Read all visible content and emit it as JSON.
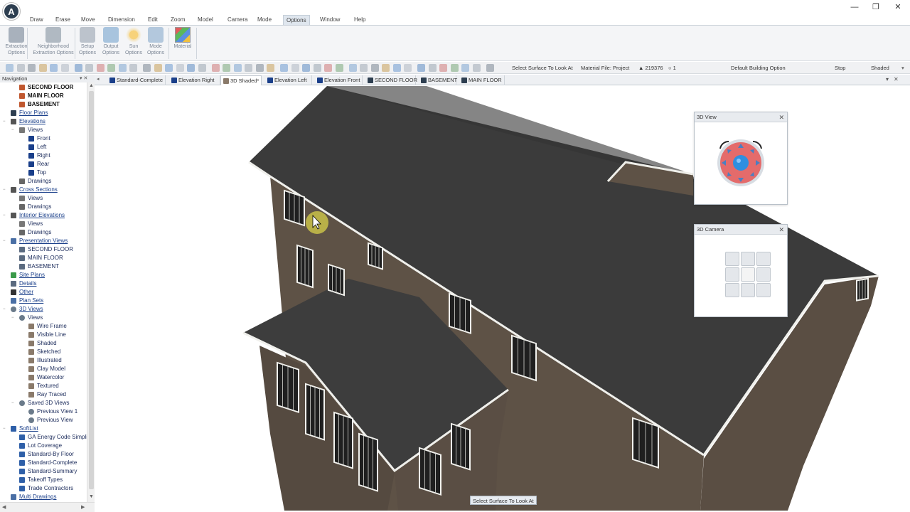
{
  "titlebar": {
    "minimize": "—",
    "restore": "❐",
    "close": "✕",
    "logo": "A"
  },
  "menu": [
    "Draw",
    "Erase",
    "Move",
    "Dimension",
    "Edit",
    "Zoom",
    "Model",
    "Camera",
    "Mode",
    "Options",
    "Window",
    "Help"
  ],
  "menu_active": "Options",
  "ribbon": [
    {
      "label1": "Extraction",
      "label2": "Options",
      "icon": "hammer-icon"
    },
    {
      "label1": "Neighborhood",
      "label2": "Extraction Options",
      "icon": "neighborhood-icon"
    },
    {
      "label1": "Setup",
      "label2": "Options",
      "icon": "setup-icon"
    },
    {
      "label1": "Output",
      "label2": "Options",
      "icon": "output-arrow-icon"
    },
    {
      "label1": "Sun",
      "label2": "Options",
      "icon": "sun-icon"
    },
    {
      "label1": "Mode",
      "label2": "Options",
      "icon": "house-icon"
    },
    {
      "label1": "Material",
      "label2": "",
      "icon": "material-swatch-icon"
    }
  ],
  "toolbar": {
    "select_surface": "Select Surface To Look At",
    "material_file": "Material File: Project",
    "count": "▲ 219376",
    "counter2": "○ 1",
    "building_option": "Default Building Option",
    "stop": "Stop",
    "render_mode": "Shaded"
  },
  "navigation": {
    "title": "Navigation",
    "pin": "▾ ✕",
    "items": [
      {
        "label": "SECOND FLOOR",
        "style": "bold",
        "indent": 2,
        "icon": "floor-icon"
      },
      {
        "label": "MAIN FLOOR",
        "style": "bold",
        "indent": 2,
        "icon": "floor-icon"
      },
      {
        "label": "BASEMENT",
        "style": "bold",
        "indent": 2,
        "icon": "floor-icon"
      },
      {
        "label": "Floor Plans",
        "style": "link",
        "indent": 1,
        "icon": "floorplan-icon"
      },
      {
        "label": "Elevations",
        "style": "link",
        "indent": 1,
        "icon": "house-icon",
        "exp": "−"
      },
      {
        "label": "Views",
        "style": "plain",
        "indent": 2,
        "icon": "folder-icon",
        "exp": "−"
      },
      {
        "label": "Front",
        "style": "plain",
        "indent": 3,
        "icon": "arrow-up-icon"
      },
      {
        "label": "Left",
        "style": "plain",
        "indent": 3,
        "icon": "arrow-right-icon"
      },
      {
        "label": "Right",
        "style": "plain",
        "indent": 3,
        "icon": "arrow-left-icon"
      },
      {
        "label": "Rear",
        "style": "plain",
        "indent": 3,
        "icon": "arrow-down-icon"
      },
      {
        "label": "Top",
        "style": "plain",
        "indent": 3,
        "icon": "top-view-icon"
      },
      {
        "label": "Drawings",
        "style": "plain",
        "indent": 2,
        "icon": "drawing-icon"
      },
      {
        "label": "Cross Sections",
        "style": "link",
        "indent": 1,
        "icon": "house-icon",
        "exp": "−"
      },
      {
        "label": "Views",
        "style": "plain",
        "indent": 2,
        "icon": "folder-icon"
      },
      {
        "label": "Drawings",
        "style": "plain",
        "indent": 2,
        "icon": "drawing-icon"
      },
      {
        "label": "Interior Elevations",
        "style": "link",
        "indent": 1,
        "icon": "interior-icon",
        "exp": "−"
      },
      {
        "label": "Views",
        "style": "plain",
        "indent": 2,
        "icon": "folder-icon"
      },
      {
        "label": "Drawings",
        "style": "plain",
        "indent": 2,
        "icon": "drawing-icon"
      },
      {
        "label": "Presentation Views",
        "style": "link",
        "indent": 1,
        "icon": "presentation-icon",
        "exp": "−"
      },
      {
        "label": "SECOND FLOOR",
        "style": "plain",
        "indent": 2,
        "icon": "sheet-icon"
      },
      {
        "label": "MAIN FLOOR",
        "style": "plain",
        "indent": 2,
        "icon": "sheet-icon"
      },
      {
        "label": "BASEMENT",
        "style": "plain",
        "indent": 2,
        "icon": "sheet-icon"
      },
      {
        "label": "Site Plans",
        "style": "link",
        "indent": 1,
        "icon": "site-plan-icon"
      },
      {
        "label": "Details",
        "style": "link",
        "indent": 1,
        "icon": "details-icon"
      },
      {
        "label": "Other",
        "style": "link",
        "indent": 1,
        "icon": "other-icon"
      },
      {
        "label": "Plan Sets",
        "style": "link",
        "indent": 1,
        "icon": "plan-sets-icon"
      },
      {
        "label": "3D Views",
        "style": "link",
        "indent": 1,
        "icon": "eye-icon",
        "exp": "−"
      },
      {
        "label": "Views",
        "style": "plain",
        "indent": 2,
        "icon": "eye-icon",
        "exp": "−"
      },
      {
        "label": "Wire Frame",
        "style": "plain",
        "indent": 3,
        "icon": "cube-icon"
      },
      {
        "label": "Visible Line",
        "style": "plain",
        "indent": 3,
        "icon": "cube-icon"
      },
      {
        "label": "Shaded",
        "style": "plain",
        "indent": 3,
        "icon": "cube-icon"
      },
      {
        "label": "Sketched",
        "style": "plain",
        "indent": 3,
        "icon": "cube-icon"
      },
      {
        "label": "Illustrated",
        "style": "plain",
        "indent": 3,
        "icon": "cube-icon"
      },
      {
        "label": "Clay Model",
        "style": "plain",
        "indent": 3,
        "icon": "cube-icon"
      },
      {
        "label": "Watercolor",
        "style": "plain",
        "indent": 3,
        "icon": "cube-icon"
      },
      {
        "label": "Textured",
        "style": "plain",
        "indent": 3,
        "icon": "cube-icon"
      },
      {
        "label": "Ray Traced",
        "style": "plain",
        "indent": 3,
        "icon": "cube-icon"
      },
      {
        "label": "Saved 3D Views",
        "style": "plain",
        "indent": 2,
        "icon": "eye-icon",
        "exp": "−"
      },
      {
        "label": "Previous View 1",
        "style": "plain",
        "indent": 3,
        "icon": "eye-icon"
      },
      {
        "label": "Previous View",
        "style": "plain",
        "indent": 3,
        "icon": "eye-icon"
      },
      {
        "label": "SoftList",
        "style": "link",
        "indent": 1,
        "icon": "list-icon",
        "exp": "−"
      },
      {
        "label": "GA Energy Code Simpli",
        "style": "plain",
        "indent": 2,
        "icon": "list-icon"
      },
      {
        "label": "Lot Coverage",
        "style": "plain",
        "indent": 2,
        "icon": "list-icon"
      },
      {
        "label": "Standard-By Floor",
        "style": "plain",
        "indent": 2,
        "icon": "list-icon"
      },
      {
        "label": "Standard-Complete",
        "style": "plain",
        "indent": 2,
        "icon": "list-icon"
      },
      {
        "label": "Standard-Summary",
        "style": "plain",
        "indent": 2,
        "icon": "list-icon"
      },
      {
        "label": "Takeoff Types",
        "style": "plain",
        "indent": 2,
        "icon": "list-icon"
      },
      {
        "label": "Trade Contractors",
        "style": "plain",
        "indent": 2,
        "icon": "list-icon"
      },
      {
        "label": "Multi Drawings",
        "style": "link",
        "indent": 1,
        "icon": "multi-drawing-icon"
      }
    ]
  },
  "tabs": [
    {
      "label": "Standard-Complete",
      "icon": "list-icon"
    },
    {
      "label": "Elevation Right",
      "icon": "arrow-left-icon"
    },
    {
      "label": "3D Shaded*",
      "icon": "cube-icon",
      "active": true
    },
    {
      "label": "Elevation Left",
      "icon": "arrow-right-icon"
    },
    {
      "label": "Elevation Front",
      "icon": "arrow-up-icon"
    },
    {
      "label": "SECOND FLOOR",
      "icon": "floor-icon"
    },
    {
      "label": "BASEMENT",
      "icon": "floor-icon"
    },
    {
      "label": "MAIN FLOOR",
      "icon": "floor-icon"
    }
  ],
  "tabbar_controls": {
    "dropdown": "▾",
    "close": "✕"
  },
  "panels": {
    "view3d": {
      "title": "3D View",
      "close": "✕"
    },
    "camera3d": {
      "title": "3D Camera",
      "close": "✕"
    }
  },
  "status_tip": "Select Surface To Look At",
  "colors": {
    "accent": "#1a3f8a",
    "roof": "#3a3a3a",
    "wall": "#5e5246",
    "trim": "#f2f2ee",
    "compass_outer": "#e46b6b",
    "compass_inner": "#2f8fe0"
  }
}
